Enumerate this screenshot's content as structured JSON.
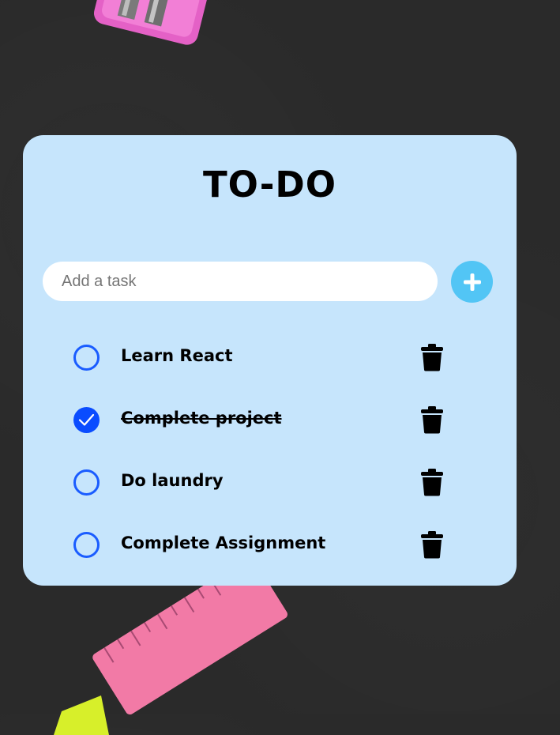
{
  "app": {
    "title": "TO-DO"
  },
  "input": {
    "placeholder": "Add a task",
    "value": ""
  },
  "add_button": {
    "icon": "plus-icon"
  },
  "tasks": [
    {
      "label": "Learn React",
      "completed": false
    },
    {
      "label": "Complete project",
      "completed": true
    },
    {
      "label": "Do laundry",
      "completed": false
    },
    {
      "label": "Complete Assignment",
      "completed": false
    }
  ],
  "colors": {
    "background": "#2a2a2a",
    "card": "#c6e5fc",
    "accent": "#52c5f5",
    "checkbox": "#1a5cff",
    "text": "#000000"
  }
}
